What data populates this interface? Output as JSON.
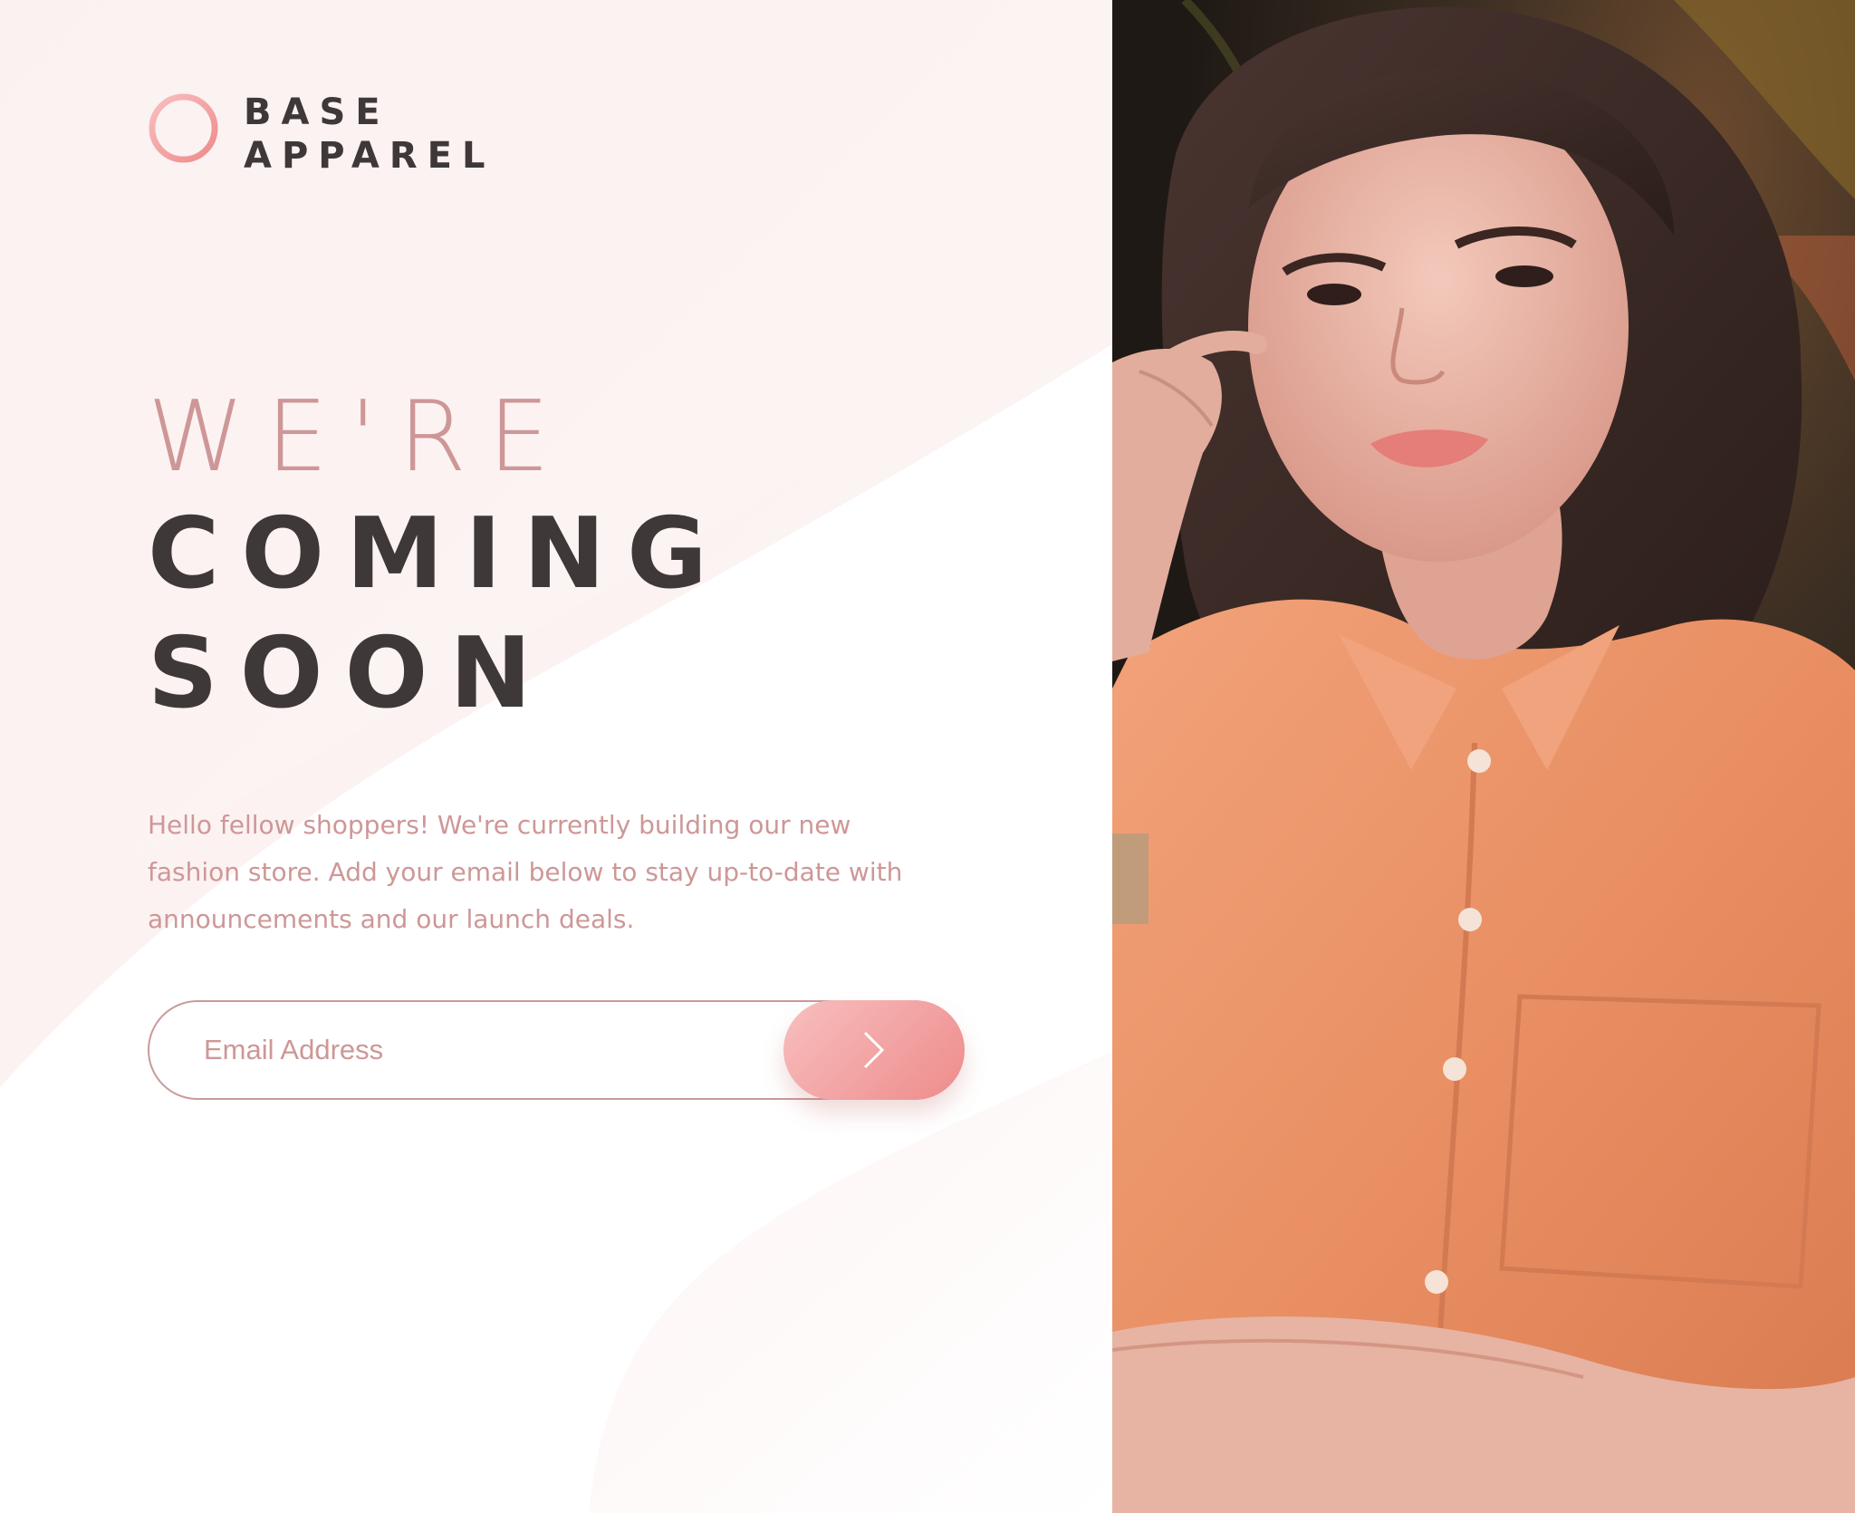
{
  "brand": {
    "name_line1": "BASE",
    "name_line2": "APPAREL",
    "logo_icon": "ring-logo-icon"
  },
  "headline": {
    "light": "WE'RE",
    "bold_line1": "COMING",
    "bold_line2": "SOON"
  },
  "description": "Hello fellow shoppers! We're currently building our new fashion store. Add your email below to stay up-to-date with announcements and our launch deals.",
  "form": {
    "email_placeholder": "Email Address",
    "email_value": "",
    "submit_icon": "chevron-right-icon"
  },
  "hero": {
    "image": "woman-in-peach-shirt-photo"
  },
  "colors": {
    "accent_pink": "#ce9797",
    "dark_text": "#3e3838",
    "button_gradient_start": "#f8bfbf",
    "button_gradient_end": "#ee8b8b"
  }
}
